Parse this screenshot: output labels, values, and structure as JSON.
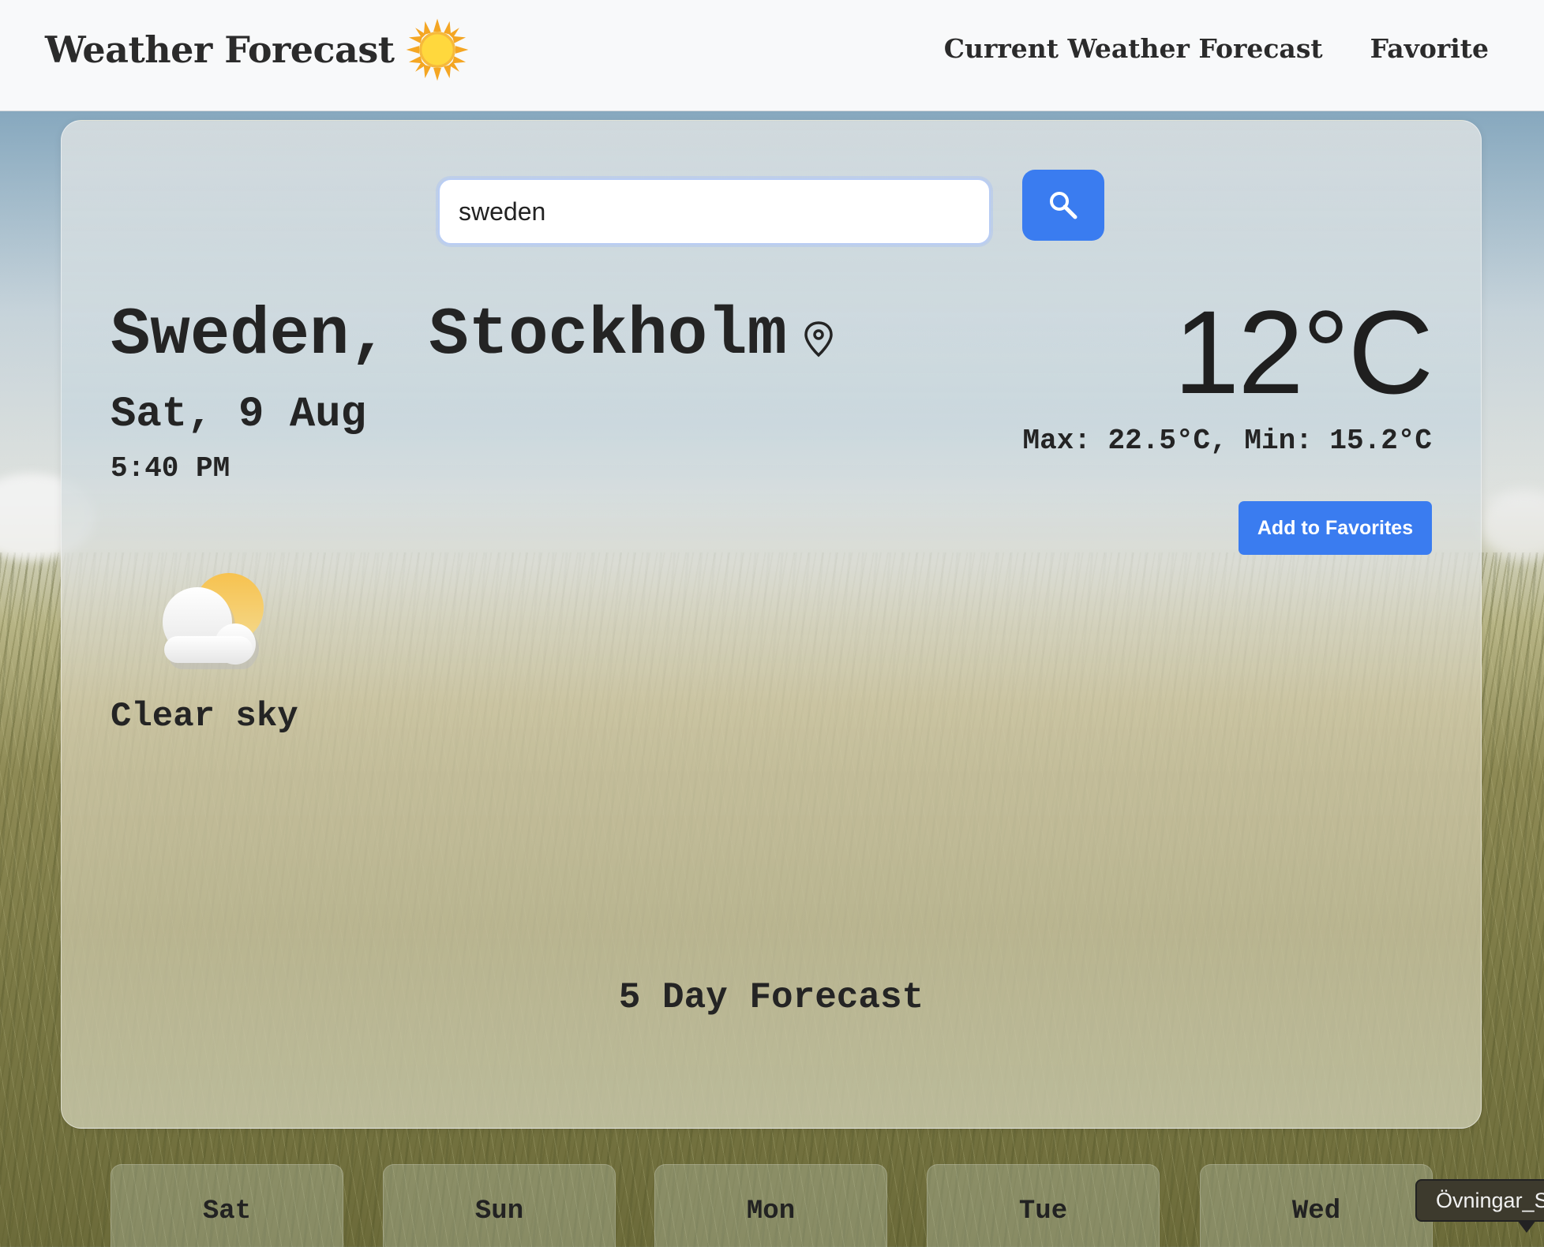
{
  "navbar": {
    "brand": "Weather Forecast",
    "links": [
      "Current Weather Forecast",
      "Favorite"
    ]
  },
  "search": {
    "value": "sweden"
  },
  "current": {
    "location": "Sweden, Stockholm",
    "date": "Sat, 9 Aug",
    "time": "5:40 PM",
    "temperature": "12°C",
    "minmax": "Max: 22.5°C, Min: 15.2°C",
    "favorite_label": "Add to Favorites",
    "description": "Clear sky",
    "icon": "partly-cloudy-icon"
  },
  "forecast": {
    "title": "5 Day Forecast",
    "days": [
      "Sat",
      "Sun",
      "Mon",
      "Tue",
      "Wed"
    ]
  },
  "tooltip": {
    "text": "Övningar_S"
  },
  "colors": {
    "accent": "#3a7cf0",
    "navbar_bg": "#f8f9fa",
    "text": "#242424"
  }
}
